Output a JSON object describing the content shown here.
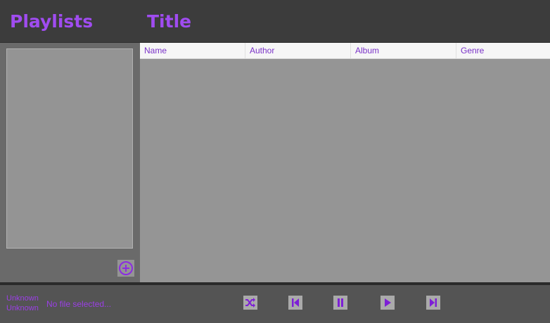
{
  "header": {
    "playlists_title": "Playlists",
    "main_title": "Title"
  },
  "table": {
    "columns": [
      "Name",
      "Author",
      "Album",
      "Genre"
    ],
    "rows": []
  },
  "sidebar": {
    "playlists": [],
    "add_icon": "add-circle-icon"
  },
  "player": {
    "track_title": "Unknown",
    "track_artist": "Unknown",
    "file_status": "No file selected...",
    "controls": [
      "shuffle-icon",
      "previous-icon",
      "pause-icon",
      "play-icon",
      "next-icon"
    ]
  },
  "colors": {
    "accent": "#a04cf0",
    "header_bg": "#3c3c3c",
    "sidebar_bg": "#6a6a6a",
    "content_bg": "#959595",
    "player_bg": "#545454"
  }
}
